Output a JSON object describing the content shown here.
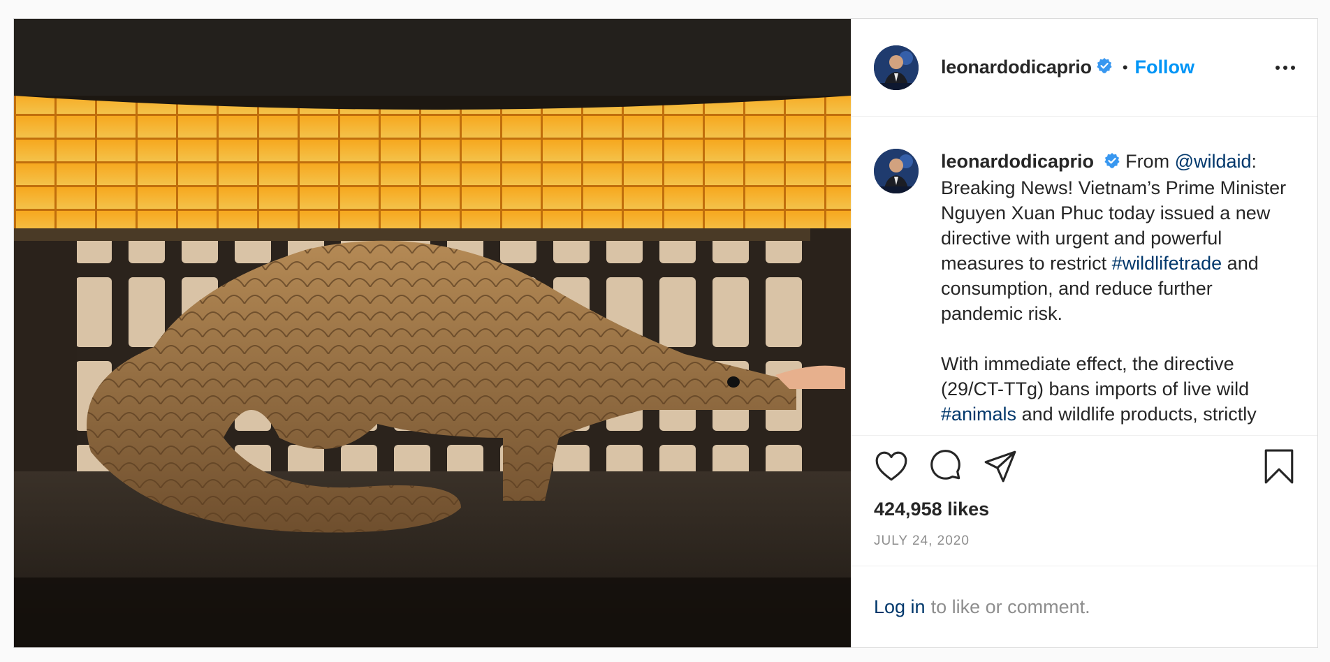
{
  "header": {
    "username": "leonardodicaprio",
    "separator": "•",
    "follow_label": "Follow"
  },
  "caption": {
    "username": "leonardodicaprio",
    "p1": {
      "t1": "From ",
      "mention": "@wildaid",
      "t2": ": Breaking News! Vietnam’s Prime Minister Nguyen Xuan Phuc today issued a new directive with urgent and powerful measures to restrict ",
      "hashtag": "#wildlifetrade",
      "t3": " and consumption, and reduce further pandemic risk."
    },
    "p2": {
      "t1": "With immediate effect, the directive (29/CT-TTg) bans imports of live wild ",
      "hashtag": "#animals",
      "t2": " and wildlife products, strictly"
    }
  },
  "engagement": {
    "likes": "424,958 likes",
    "date": "JULY 24, 2020"
  },
  "footer": {
    "login_label": "Log in",
    "login_rest": "to like or comment."
  },
  "colors": {
    "accent": "#0095f6",
    "link": "#00376b",
    "verified": "#3897f0",
    "muted": "#8e8e8e"
  },
  "icons": [
    "heart-icon",
    "comment-icon",
    "share-icon",
    "bookmark-icon",
    "verified-badge-icon",
    "more-options-icon"
  ]
}
